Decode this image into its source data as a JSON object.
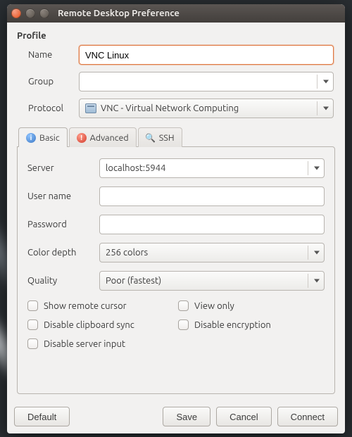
{
  "window": {
    "title": "Remote Desktop Preference"
  },
  "profile": {
    "section_label": "Profile",
    "name_label": "Name",
    "name_value": "VNC Linux",
    "group_label": "Group",
    "group_value": "",
    "protocol_label": "Protocol",
    "protocol_value": "VNC - Virtual Network Computing"
  },
  "tabs": {
    "basic": "Basic",
    "advanced": "Advanced",
    "ssh": "SSH"
  },
  "basic": {
    "server_label": "Server",
    "server_value": "localhost:5944",
    "username_label": "User name",
    "username_value": "",
    "password_label": "Password",
    "password_value": "",
    "colordepth_label": "Color depth",
    "colordepth_value": "256 colors",
    "quality_label": "Quality",
    "quality_value": "Poor (fastest)",
    "chk_show_remote_cursor": "Show remote cursor",
    "chk_view_only": "View only",
    "chk_disable_clipboard": "Disable clipboard sync",
    "chk_disable_encryption": "Disable encryption",
    "chk_disable_server_input": "Disable server input"
  },
  "buttons": {
    "default": "Default",
    "save": "Save",
    "cancel": "Cancel",
    "connect": "Connect"
  }
}
